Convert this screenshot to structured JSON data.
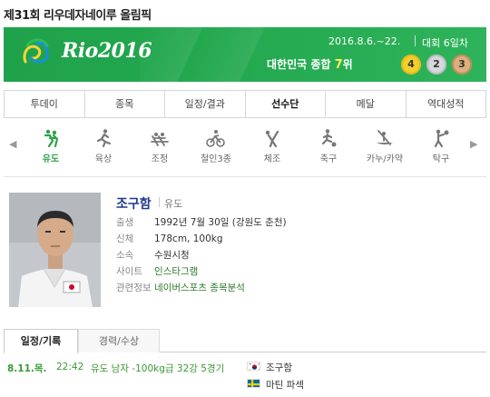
{
  "page_title": "제31회 리우데자네이루 올림픽",
  "banner": {
    "logo_text": "Rio2016",
    "date_range": "2016.8.6.~22.",
    "day_label": "대회 6일차",
    "rank_prefix": "대한민국 종합",
    "rank_number": "7",
    "rank_suffix": "위",
    "medals": {
      "gold": "4",
      "silver": "2",
      "bronze": "3"
    },
    "colors": {
      "green": "#23a84f",
      "gold": "#f3cf2c",
      "silver": "#d5d7da",
      "bronze": "#dcae80"
    }
  },
  "tabs": [
    {
      "label": "투데이"
    },
    {
      "label": "종목"
    },
    {
      "label": "일정/결과"
    },
    {
      "label": "선수단"
    },
    {
      "label": "메달"
    },
    {
      "label": "역대성적"
    }
  ],
  "active_tab": "선수단",
  "sports": [
    {
      "label": "유도",
      "icon": "judo-icon"
    },
    {
      "label": "육상",
      "icon": "athletics-icon"
    },
    {
      "label": "조정",
      "icon": "rowing-icon"
    },
    {
      "label": "철인3종",
      "icon": "triathlon-icon"
    },
    {
      "label": "체조",
      "icon": "gymnastics-icon"
    },
    {
      "label": "축구",
      "icon": "football-icon"
    },
    {
      "label": "카누/카약",
      "icon": "canoe-icon"
    },
    {
      "label": "탁구",
      "icon": "table-tennis-icon"
    }
  ],
  "active_sport": "유도",
  "profile": {
    "name": "조구함",
    "sport": "유도",
    "fields": [
      {
        "key": "출생",
        "value": "1992년 7월 30일 (강원도 춘천)"
      },
      {
        "key": "신체",
        "value": "178cm, 100kg"
      },
      {
        "key": "소속",
        "value": "수원시청"
      },
      {
        "key": "사이트",
        "value": "인스타그램"
      },
      {
        "key": "관련정보",
        "value": "네이버스포츠 종목분석"
      }
    ]
  },
  "schedule_tabs": [
    {
      "label": "일정/기록"
    },
    {
      "label": "경력/수상"
    }
  ],
  "event": {
    "date": "8.11.목.",
    "time": "22:42",
    "description": "유도 남자 -100kg급 32강 5경기",
    "athletes": [
      {
        "name": "조구함",
        "flag": "korea"
      },
      {
        "name": "마틴 파섹",
        "flag": "sweden"
      }
    ]
  }
}
